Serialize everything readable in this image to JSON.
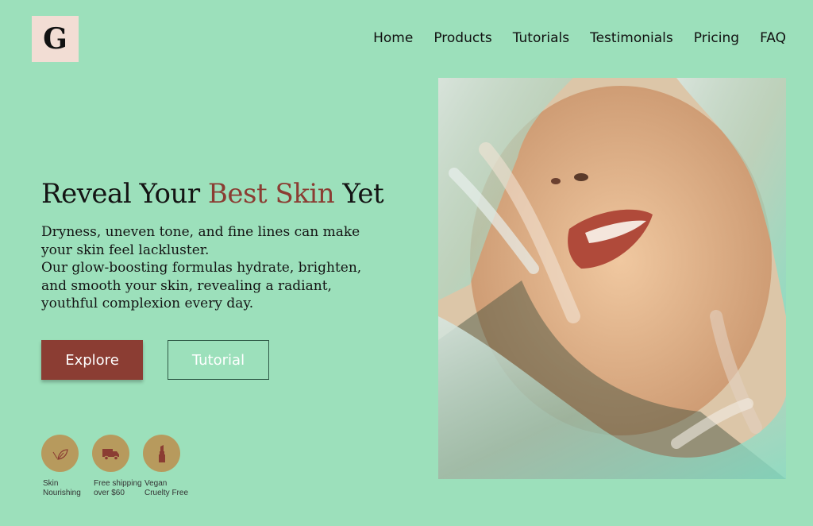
{
  "logo": {
    "letter": "G"
  },
  "nav": {
    "items": [
      "Home",
      "Products",
      "Tutorials",
      "Testimonials",
      "Pricing",
      "FAQ"
    ]
  },
  "hero": {
    "headline_start": "Reveal Your ",
    "headline_accent": "Best Skin",
    "headline_end": " Yet",
    "paragraph_1": "Dryness, uneven tone, and fine lines can make your skin feel lackluster.",
    "paragraph_2": "Our glow-boosting formulas hydrate, brighten, and smooth your skin, revealing a radiant, youthful complexion every day."
  },
  "buttons": {
    "explore": "Explore",
    "tutorial": "Tutorial"
  },
  "features": [
    {
      "icon": "leaf-icon",
      "label": "Skin\nNourishing"
    },
    {
      "icon": "truck-icon",
      "label": "Free shipping\nover $60"
    },
    {
      "icon": "lipstick-icon",
      "label": "Vegan\nCruelty Free"
    }
  ],
  "colors": {
    "background": "#9ce0bb",
    "accent": "#8b3d33",
    "logo_bg": "#f2ddd4",
    "feature_circle": "#b79a5d"
  }
}
